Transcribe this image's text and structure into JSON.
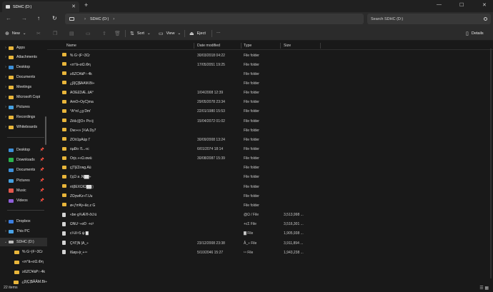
{
  "window": {
    "tab_title": "SDHC (D:)",
    "tab_close": "✕",
    "new_tab": "+",
    "minimize": "—",
    "maximize": "☐",
    "close": "✕"
  },
  "address": {
    "back": "←",
    "forward": "→",
    "up": "↑",
    "refresh": "↻",
    "chevron_a": "›",
    "path_segment": "SDHC (D:)",
    "chevron_b": "›",
    "search_placeholder": "Search SDHC (D:)"
  },
  "toolbar": {
    "new_label": "New",
    "new_chevron": "⌄",
    "sort_label": "Sort",
    "sort_chevron": "⌄",
    "view_label": "View",
    "view_chevron": "⌄",
    "eject_label": "Eject",
    "more_label": "···",
    "details_label": "Details"
  },
  "sidebar": {
    "items": [
      {
        "label": "Apps"
      },
      {
        "label": "Attachments"
      },
      {
        "label": "Desktop"
      },
      {
        "label": "Documents"
      },
      {
        "label": "Meetings"
      },
      {
        "label": "Microsoft Copi"
      },
      {
        "label": "Pictures"
      },
      {
        "label": "Recordings"
      },
      {
        "label": "Whiteboards"
      }
    ],
    "quick": [
      {
        "label": "Desktop"
      },
      {
        "label": "Downloads"
      },
      {
        "label": "Documents"
      },
      {
        "label": "Pictures"
      },
      {
        "label": "Music"
      },
      {
        "label": "Videos"
      }
    ],
    "locations": [
      {
        "label": "Dropbox"
      },
      {
        "label": "This PC"
      },
      {
        "label": "SDHC (D:)"
      }
    ],
    "drive_children": [
      {
        "label": "% G~|F~3Cr"
      },
      {
        "label": "«π°â÷σΩ.Φη"
      },
      {
        "label": "≥ßZC¥àP↑·4k"
      },
      {
        "label": "¿β|Ç|$ÂÂM.Bi÷"
      }
    ]
  },
  "columns": {
    "name": "Name",
    "date": "Date modified",
    "type": "Type",
    "size": "Size"
  },
  "rows": [
    {
      "name": "% G~|F~3Cr",
      "date": "30/03/2018 04:22",
      "type": "File folder",
      "size": "",
      "kind": "folder"
    },
    {
      "name": "«π°â÷σΩ.Φη",
      "date": "17/05/2051 19:25",
      "type": "File folder",
      "size": "",
      "kind": "folder"
    },
    {
      "name": "≥ßZC¥àP↑·4k",
      "date": "",
      "type": "File folder",
      "size": "",
      "kind": "folder"
    },
    {
      "name": "¿β|Ç|$ÂÂM.Bi÷",
      "date": "",
      "type": "File folder",
      "size": "",
      "kind": "folder"
    },
    {
      "name": "AÔÈ£DÆ..ûA°",
      "date": "1/04/2008 12:39",
      "type": "File folder",
      "size": "",
      "kind": "folder"
    },
    {
      "name": "AmÖ÷ÖyC}ma",
      "date": "29/05/2078 23:34",
      "type": "File folder",
      "size": "",
      "kind": "folder"
    },
    {
      "name": "°Ä°rd ¿g Dm'",
      "date": "22/01/1980 15:53",
      "type": "File folder",
      "size": "",
      "kind": "folder"
    },
    {
      "name": "Zèâ-|{|Ô» Po·ij",
      "date": "15/04/2072 01:02",
      "type": "File folder",
      "size": "",
      "kind": "folder"
    },
    {
      "name": "Dw»«« }¼À.Dy7",
      "date": "",
      "type": "File folder",
      "size": "",
      "kind": "folder"
    },
    {
      "name": "ŽÕö1pÅùp Γ",
      "date": "30/09/2008 13:24",
      "type": "File folder",
      "size": "",
      "kind": "folder"
    },
    {
      "name": "oµÐo í'L..«c",
      "date": "6/01/2074 18:14",
      "type": "File folder",
      "size": "",
      "kind": "folder"
    },
    {
      "name": "Õrjc.»«Ω.αwü",
      "date": "30/08/2087 15:39",
      "type": "File folder",
      "size": "",
      "kind": "folder"
    },
    {
      "name": "ç|Τ|£Σrwg.Âü",
      "date": "",
      "type": "File folder",
      "size": "",
      "kind": "folder"
    },
    {
      "name": "ì¦çΩ a .Ñ██÷",
      "date": "",
      "type": "File folder",
      "size": "",
      "kind": "folder"
    },
    {
      "name": "róβÉXΩIΩ██▯",
      "date": "",
      "type": "File folder",
      "size": "",
      "kind": "folder"
    },
    {
      "name": "ZΩγwKz÷Γ.Uu",
      "date": "",
      "type": "File folder",
      "size": "",
      "kind": "folder"
    },
    {
      "name": "ø«ƒm¥y÷âc.z G",
      "date": "",
      "type": "File folder",
      "size": "",
      "kind": "folder"
    },
    {
      "name": "«be·g¾Æ®·ð∅ú",
      "date": "",
      "type": "@Ω / File",
      "size": "3,513,998 ...",
      "kind": "file"
    },
    {
      "name": "ΩÑU⁻÷σD ·+c²",
      "date": "",
      "type": "+cΣ File",
      "size": "3,516,301 ...",
      "kind": "file"
    },
    {
      "name": "c¼X⁹S ψ ▇",
      "date": "",
      "type": "▇ File",
      "size": "1,905,938 ...",
      "kind": "file"
    },
    {
      "name": "Ç³ÍΓ|Ñ |Ä_÷",
      "date": "23/12/2008 23:38",
      "type": "Â_÷ File",
      "size": "3,911,894 ...",
      "kind": "file"
    },
    {
      "name": "Ì6øp»|r¸+¹⁴",
      "date": "5/10/2046 15:27",
      "type": "¹⁴ File",
      "size": "1,943,238 ...",
      "kind": "file"
    }
  ],
  "status": {
    "count": "22 items",
    "view_icons": "☰ ▦"
  }
}
